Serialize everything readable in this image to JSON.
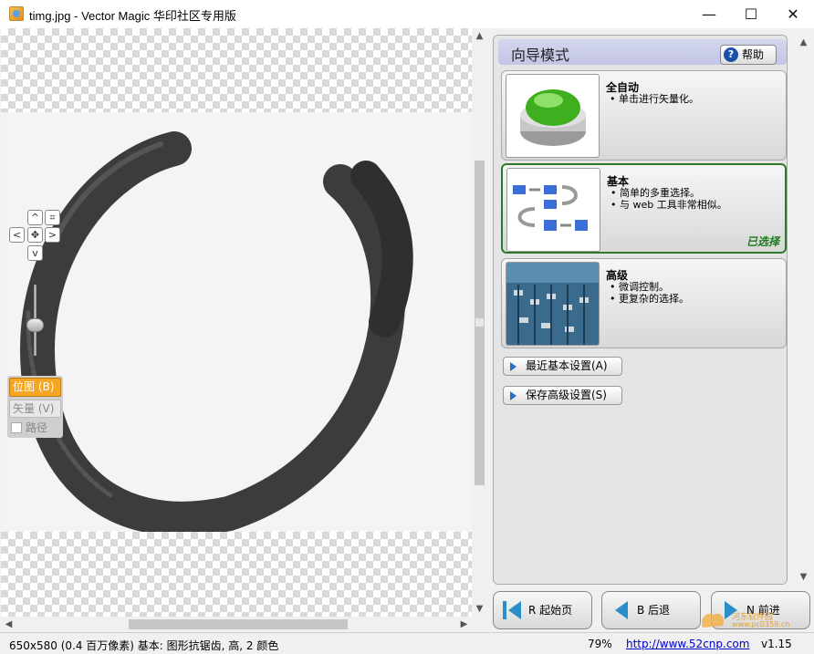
{
  "window": {
    "title": "timg.jpg - Vector Magic 华印社区专用版",
    "minimize_glyph": "—",
    "maximize_glyph": "☐",
    "close_glyph": "✕"
  },
  "canvas": {
    "nav": {
      "up": "^",
      "down": "v",
      "left": "<",
      "right": ">"
    },
    "zoom_level": 0.35,
    "modes": {
      "bitmap": "位图 (B)",
      "vector": "矢量 (V)",
      "path": "路径"
    }
  },
  "wizard": {
    "title": "向导模式",
    "help_label": "帮助",
    "options": [
      {
        "title": "全自动",
        "bullets": [
          "单击进行矢量化。"
        ]
      },
      {
        "title": "基本",
        "bullets": [
          "简单的多重选择。",
          "与 web 工具非常相似。"
        ],
        "selected_label": "已选择"
      },
      {
        "title": "高级",
        "bullets": [
          "微调控制。",
          "更复杂的选择。"
        ]
      }
    ],
    "recent_basic": "最近基本设置(A)",
    "save_advanced": "保存高级设置(S)"
  },
  "footer": {
    "start_page": "R 起始页",
    "back": "B 后退",
    "next": "N 前进"
  },
  "watermark": {
    "line1": "河东软件园",
    "line2": "www.pc0359.cn"
  },
  "status": {
    "info": "650x580 (0.4 百万像素) 基本: 图形抗锯齿, 高, 2 颜色",
    "zoom": "79%",
    "url": "http://www.52cnp.com",
    "version": "v1.15"
  },
  "colors": {
    "accent_orange": "#f5a623",
    "selected_green": "#2b7a2b",
    "help_blue": "#1c4fa8"
  }
}
